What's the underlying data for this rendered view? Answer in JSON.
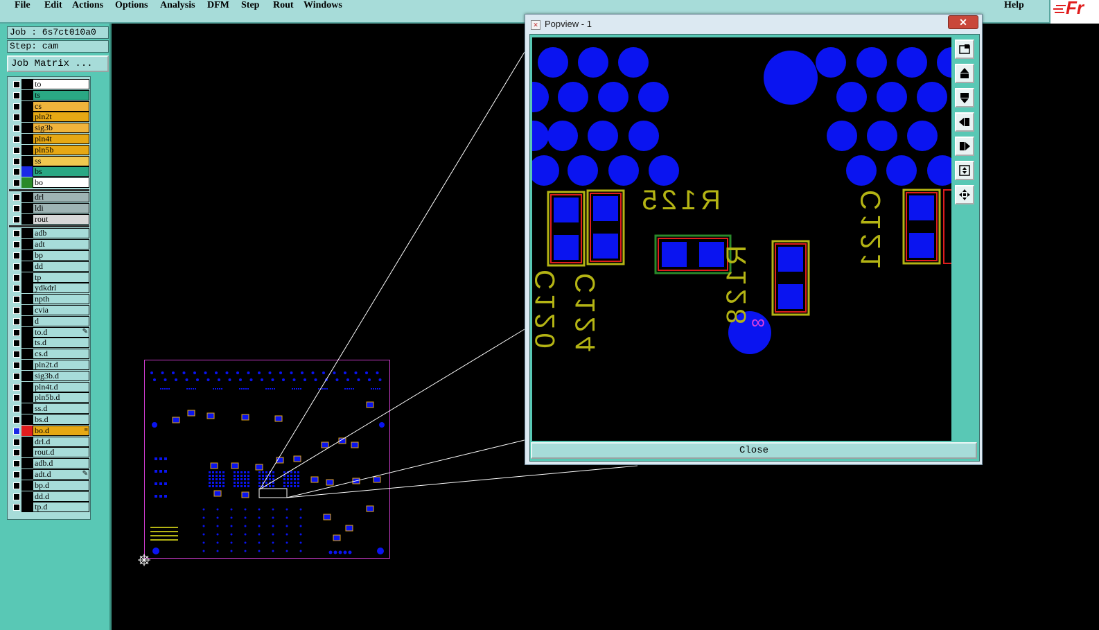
{
  "menu": {
    "file": "File",
    "edit": "Edit",
    "actions": "Actions",
    "options": "Options",
    "analysis": "Analysis",
    "dfm": "DFM",
    "step": "Step",
    "rout": "Rout",
    "windows": "Windows",
    "help": "Help"
  },
  "brand": {
    "text": "Fr"
  },
  "sidebar": {
    "job": "Job : 6s7ct010a0",
    "step": "Step: cam",
    "job_matrix_button": "Job Matrix ..."
  },
  "layers": [
    {
      "name": "to",
      "color": "#ffffff",
      "indicator": "#000000",
      "mark": ""
    },
    {
      "name": "ts",
      "color": "#2aa884",
      "indicator": "#000000",
      "mark": ""
    },
    {
      "name": "cs",
      "color": "#f0b43c",
      "indicator": "#000000",
      "mark": ""
    },
    {
      "name": "pln2t",
      "color": "#e6a814",
      "indicator": "#000000",
      "mark": ""
    },
    {
      "name": "sig3b",
      "color": "#f0b43c",
      "indicator": "#000000",
      "mark": ""
    },
    {
      "name": "pln4t",
      "color": "#e6a814",
      "indicator": "#000000",
      "mark": ""
    },
    {
      "name": "pln5b",
      "color": "#e6a814",
      "indicator": "#000000",
      "mark": ""
    },
    {
      "name": "ss",
      "color": "#f0c850",
      "indicator": "#000000",
      "mark": ""
    },
    {
      "name": "bs",
      "color": "#2aa884",
      "indicator": "#1a2ae6",
      "mark": ""
    },
    {
      "name": "bo",
      "color": "#ffffff",
      "indicator": "#2a8a2a",
      "mark": ""
    },
    {
      "name": "drl",
      "color": "#9eb4b4",
      "indicator": "#000000",
      "mark": ""
    },
    {
      "name": "ldi",
      "color": "#9eb4b4",
      "indicator": "#000000",
      "mark": ""
    },
    {
      "name": "rout",
      "color": "#d8d8d8",
      "indicator": "#000000",
      "mark": ""
    },
    {
      "name": "adb",
      "color": "#a7dcd9",
      "indicator": "#000000",
      "mark": ""
    },
    {
      "name": "adt",
      "color": "#a7dcd9",
      "indicator": "#000000",
      "mark": ""
    },
    {
      "name": "bp",
      "color": "#a7dcd9",
      "indicator": "#000000",
      "mark": ""
    },
    {
      "name": "dd",
      "color": "#a7dcd9",
      "indicator": "#000000",
      "mark": ""
    },
    {
      "name": "tp",
      "color": "#a7dcd9",
      "indicator": "#000000",
      "mark": ""
    },
    {
      "name": "ydkdrl",
      "color": "#a7dcd9",
      "indicator": "#000000",
      "mark": ""
    },
    {
      "name": "npth",
      "color": "#a7dcd9",
      "indicator": "#000000",
      "mark": ""
    },
    {
      "name": "cvia",
      "color": "#a7dcd9",
      "indicator": "#000000",
      "mark": ""
    },
    {
      "name": "d",
      "color": "#a7dcd9",
      "indicator": "#000000",
      "mark": ""
    },
    {
      "name": "to.d",
      "color": "#a7dcd9",
      "indicator": "#000000",
      "mark": "✎"
    },
    {
      "name": "ts.d",
      "color": "#a7dcd9",
      "indicator": "#000000",
      "mark": ""
    },
    {
      "name": "cs.d",
      "color": "#a7dcd9",
      "indicator": "#000000",
      "mark": ""
    },
    {
      "name": "pln2t.d",
      "color": "#a7dcd9",
      "indicator": "#000000",
      "mark": ""
    },
    {
      "name": "sig3b.d",
      "color": "#a7dcd9",
      "indicator": "#000000",
      "mark": ""
    },
    {
      "name": "pln4t.d",
      "color": "#a7dcd9",
      "indicator": "#000000",
      "mark": ""
    },
    {
      "name": "pln5b.d",
      "color": "#a7dcd9",
      "indicator": "#000000",
      "mark": ""
    },
    {
      "name": "ss.d",
      "color": "#a7dcd9",
      "indicator": "#000000",
      "mark": ""
    },
    {
      "name": "bs.d",
      "color": "#a7dcd9",
      "indicator": "#000000",
      "mark": ""
    },
    {
      "name": "bo.d",
      "color": "#e6a814",
      "indicator": "#e01d1d",
      "mark": "≡",
      "active": true
    },
    {
      "name": "drl.d",
      "color": "#a7dcd9",
      "indicator": "#000000",
      "mark": ""
    },
    {
      "name": "rout.d",
      "color": "#a7dcd9",
      "indicator": "#000000",
      "mark": ""
    },
    {
      "name": "adb.d",
      "color": "#a7dcd9",
      "indicator": "#000000",
      "mark": ""
    },
    {
      "name": "adt.d",
      "color": "#a7dcd9",
      "indicator": "#000000",
      "mark": "✎"
    },
    {
      "name": "bp.d",
      "color": "#a7dcd9",
      "indicator": "#000000",
      "mark": ""
    },
    {
      "name": "dd.d",
      "color": "#a7dcd9",
      "indicator": "#000000",
      "mark": ""
    },
    {
      "name": "tp.d",
      "color": "#a7dcd9",
      "indicator": "#000000",
      "mark": ""
    }
  ],
  "popview": {
    "title": "Popview - 1",
    "close_x": "✕",
    "close_button": "Close",
    "designators": [
      "C120",
      "C124",
      "R125",
      "R128",
      "C121"
    ]
  },
  "colors": {
    "pad": "#0a14f0",
    "silk": "#b4b414",
    "outline_red": "#e01d1d",
    "outline_green": "#2a8a2a",
    "board_outline": "#c83ac8",
    "accent_magenta": "#e040e0"
  }
}
